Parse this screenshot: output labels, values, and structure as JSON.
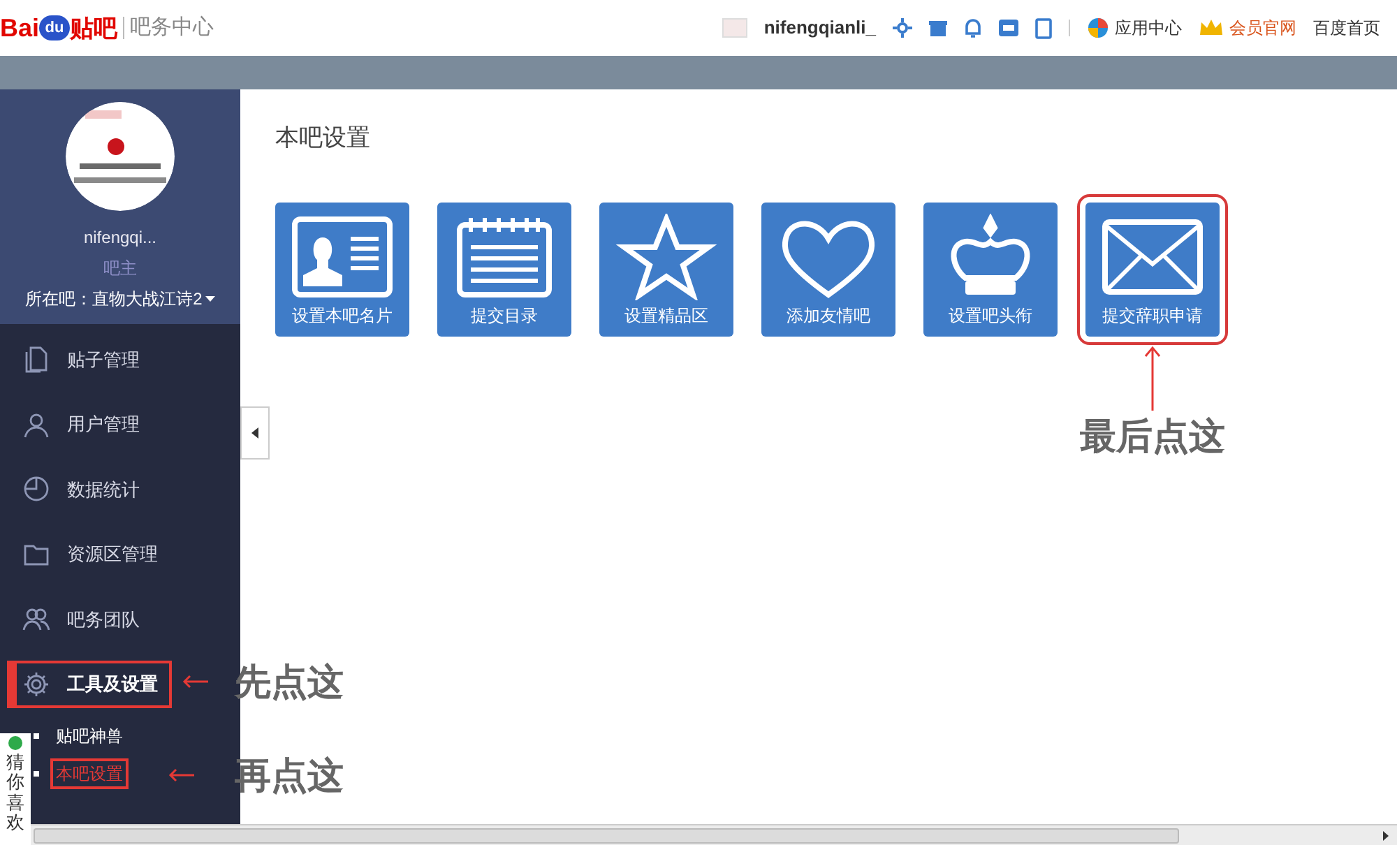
{
  "header": {
    "logo": [
      "Bai",
      "du",
      "贴吧"
    ],
    "section": "吧务中心",
    "username": "nifengqianli_",
    "links": [
      {
        "kind": "app",
        "label": "应用中心"
      },
      {
        "kind": "vip",
        "label": "会员官网"
      },
      {
        "kind": "home",
        "label": "百度首页"
      }
    ]
  },
  "profile": {
    "name": "nifengqi...",
    "role": "吧主",
    "forum": "所在吧：直物大战江诗2"
  },
  "menu": [
    {
      "label": "贴子管理",
      "selected": false
    },
    {
      "label": "用户管理",
      "selected": false
    },
    {
      "label": "数据统计",
      "selected": false
    },
    {
      "label": "资源区管理",
      "selected": false
    },
    {
      "label": "吧务团队",
      "selected": false
    },
    {
      "label": "工具及设置",
      "selected": true,
      "callout": "先点这",
      "children": [
        {
          "label": "贴吧神兽",
          "selected": false
        },
        {
          "label": "本吧设置",
          "selected": true,
          "callout": "再点这"
        }
      ]
    }
  ],
  "side_widget": "猜你喜欢",
  "page_title": "本吧设置",
  "tiles": [
    {
      "label": "设置本吧名片"
    },
    {
      "label": "提交目录"
    },
    {
      "label": "设置精品区"
    },
    {
      "label": "添加友情吧"
    },
    {
      "label": "设置吧头衔"
    },
    {
      "label": "提交辞职申请",
      "callout": "最后点这"
    }
  ]
}
